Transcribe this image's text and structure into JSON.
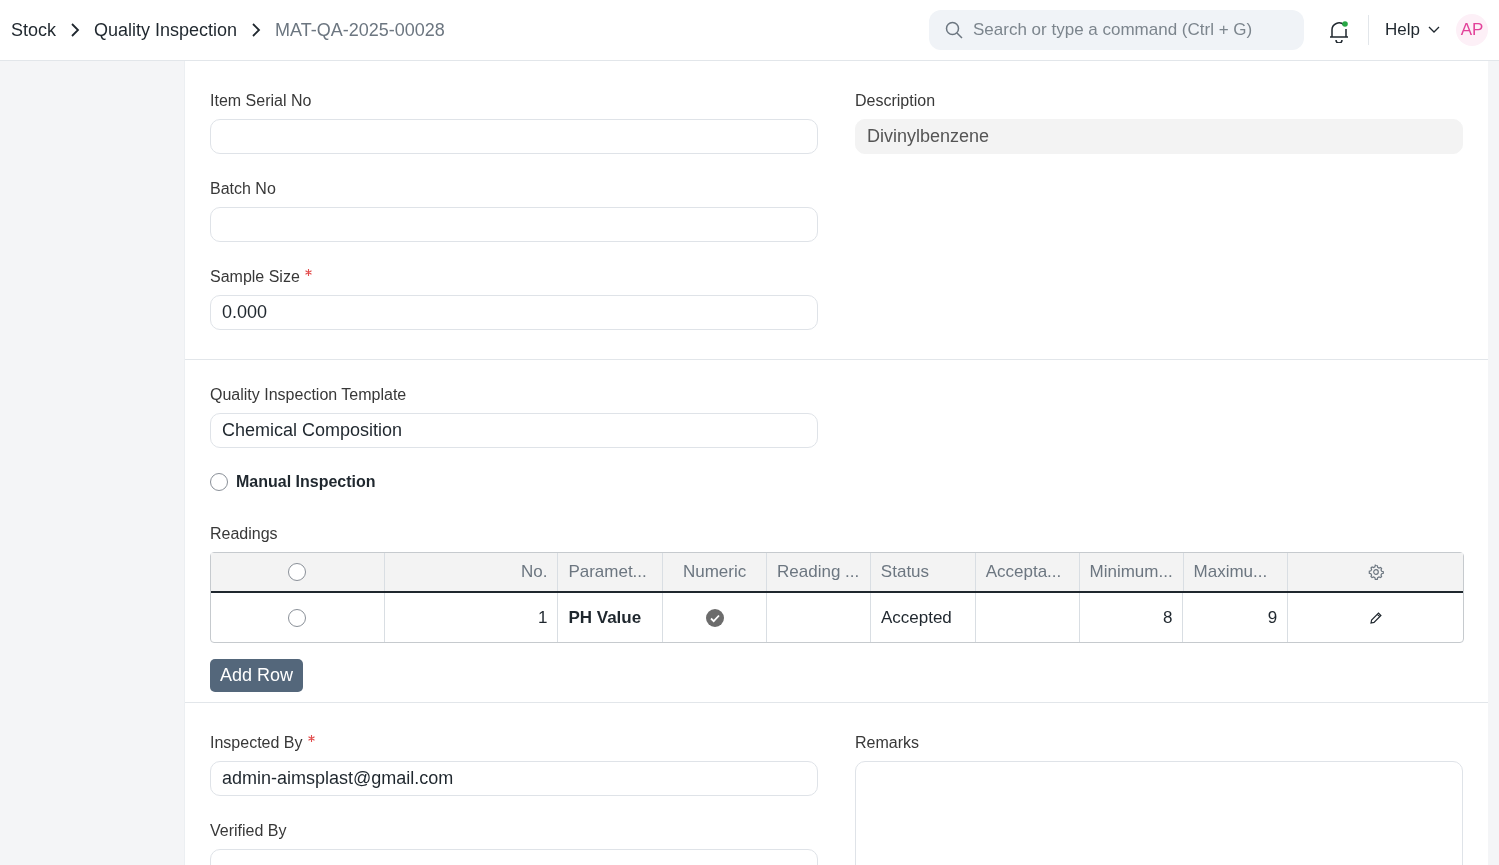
{
  "breadcrumbs": [
    {
      "label": "Stock"
    },
    {
      "label": "Quality Inspection"
    }
  ],
  "current_doc": "MAT-QA-2025-00028",
  "search": {
    "placeholder": "Search or type a command (Ctrl + G)"
  },
  "notifications": {
    "unread": true
  },
  "help": "Help",
  "avatar": "AP",
  "sections": [
    {
      "columns": [
        [
          {
            "label": "Item Serial No"
          },
          {
            "label": "Batch No"
          },
          {
            "label": "Sample Size",
            "required": true,
            "value": "0.000"
          }
        ],
        [
          {
            "label": "Description",
            "readonly": true,
            "value": "Divinylbenzene"
          }
        ]
      ]
    },
    {
      "template": {
        "label": "Quality Inspection Template",
        "value": "Chemical Composition"
      },
      "manual_inspection": {
        "label": "Manual Inspection",
        "checked": false
      },
      "readings": {
        "label": "Readings",
        "select_all": false,
        "columns": [
          {
            "label": "No."
          },
          {
            "label": "Paramet..."
          },
          {
            "label": "Numeric"
          },
          {
            "label": "Reading ..."
          },
          {
            "label": "Status"
          },
          {
            "label": "Accepta..."
          },
          {
            "label": "Minimum..."
          },
          {
            "label": "Maximu..."
          }
        ],
        "rows": [
          {
            "selected": false,
            "no": "1",
            "parameter": "PH Value",
            "numeric": true,
            "status": "Accepted",
            "min": "8",
            "max": "9"
          }
        ],
        "add_row": "Add Row"
      }
    },
    {
      "columns": [
        [
          {
            "label": "Inspected By",
            "required": true,
            "value": "admin-aimsplast@gmail.com"
          },
          {
            "label": "Verified By"
          }
        ],
        [
          {
            "label": "Remarks"
          }
        ]
      ]
    }
  ]
}
